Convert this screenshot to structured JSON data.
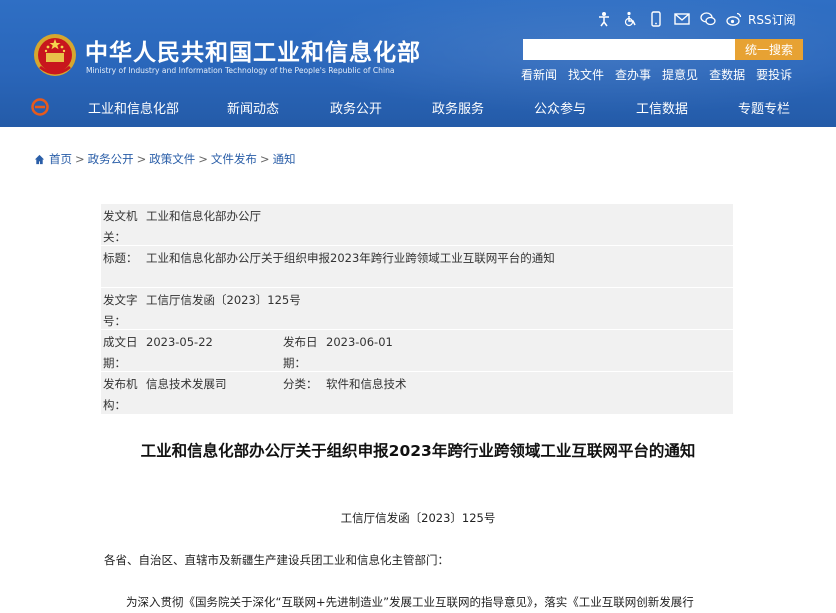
{
  "header": {
    "title": "中华人民共和国工业和信息化部",
    "subtitle": "Ministry of Industry and Information Technology of the People's Republic of China",
    "rss_label": "RSS订阅",
    "search": {
      "placeholder": "",
      "button_label": "统一搜索"
    },
    "quick_links": [
      "看新闻",
      "找文件",
      "查办事",
      "提意见",
      "查数据",
      "要投诉"
    ],
    "icons": [
      "accessibility-icon",
      "wheelchair-icon",
      "mobile-icon",
      "mail-icon",
      "wechat-icon",
      "weibo-icon"
    ]
  },
  "nav": {
    "items": [
      "工业和信息化部",
      "新闻动态",
      "政务公开",
      "政务服务",
      "公众参与",
      "工信数据",
      "专题专栏"
    ]
  },
  "breadcrumb": {
    "items": [
      "首页",
      "政务公开",
      "政策文件",
      "文件发布",
      "通知"
    ],
    "separator": ">"
  },
  "meta": {
    "issuer_label": "发文机关：",
    "issuer": "工业和信息化部办公厅",
    "title_label": "标题：",
    "title": "工业和信息化部办公厅关于组织申报2023年跨行业跨领域工业互联网平台的通知",
    "docno_label": "发文字号：",
    "docno": "工信厅信发函〔2023〕125号",
    "created_label": "成文日期：",
    "created": "2023-05-22",
    "published_label": "发布日期：",
    "published": "2023-06-01",
    "publisher_label": "发布机构：",
    "publisher": "信息技术发展司",
    "category_label": "分类：",
    "category": "软件和信息技术"
  },
  "article": {
    "title": "工业和信息化部办公厅关于组织申报2023年跨行业跨领域工业互联网平台的通知",
    "doc_number": "工信厅信发函〔2023〕125号",
    "salutation": "各省、自治区、直辖市及新疆生产建设兵团工业和信息化主管部门：",
    "para1": "为深入贯彻《国务院关于深化“互联网+先进制造业”发展工业互联网的指导意见》，落实《工业互联网创新发展行"
  },
  "colors": {
    "header_blue": "#2a66ba",
    "search_orange": "#e7a233",
    "link_blue": "#2a5ea8",
    "meta_bg": "#f1f1f1"
  }
}
